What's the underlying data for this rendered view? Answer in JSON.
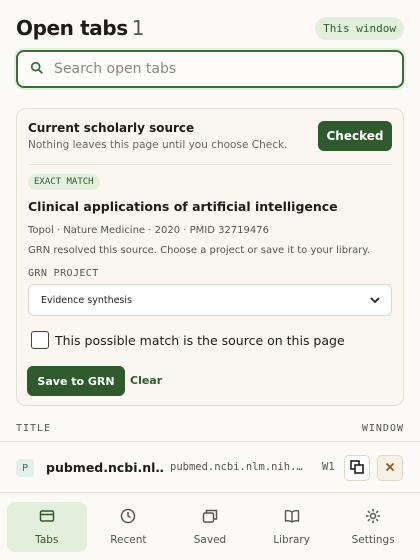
{
  "header": {
    "title": "Open tabs",
    "count": "1",
    "scope_label": "This window"
  },
  "search": {
    "placeholder": "Search open tabs",
    "value": ""
  },
  "source_card": {
    "title": "Current scholarly source",
    "subtitle": "Nothing leaves this page until you choose Check.",
    "checked_label": "Checked",
    "match_badge": "EXACT MATCH",
    "match_title": "Clinical applications of artificial intelligence",
    "match_meta": "Topol · Nature Medicine · 2020 · PMID 32719476",
    "match_note": "GRN resolved this source. Choose a project or save it to your library.",
    "project_label": "GRN PROJECT",
    "project_value": "Evidence synthesis",
    "confirm_label": "This possible match is the source on this page",
    "confirm_checked": false,
    "save_label": "Save to GRN",
    "clear_label": "Clear"
  },
  "tab_list": {
    "columns": {
      "title": "TITLE",
      "window": "WINDOW"
    },
    "rows": [
      {
        "favicon": "P",
        "title": "pubmed.ncbi.nl…",
        "url": "pubmed.ncbi.nlm.nih.…",
        "window": "W1"
      }
    ]
  },
  "nav": {
    "items": [
      {
        "label": "Tabs",
        "icon": "tabs-icon",
        "active": true
      },
      {
        "label": "Recent",
        "icon": "clock-icon",
        "active": false
      },
      {
        "label": "Saved",
        "icon": "saved-icon",
        "active": false
      },
      {
        "label": "Library",
        "icon": "book-icon",
        "active": false
      },
      {
        "label": "Settings",
        "icon": "gear-icon",
        "active": false
      }
    ]
  },
  "colors": {
    "accent": "#2e5a2e",
    "accent_soft": "#e3efdd",
    "background": "#fbfaf6"
  }
}
